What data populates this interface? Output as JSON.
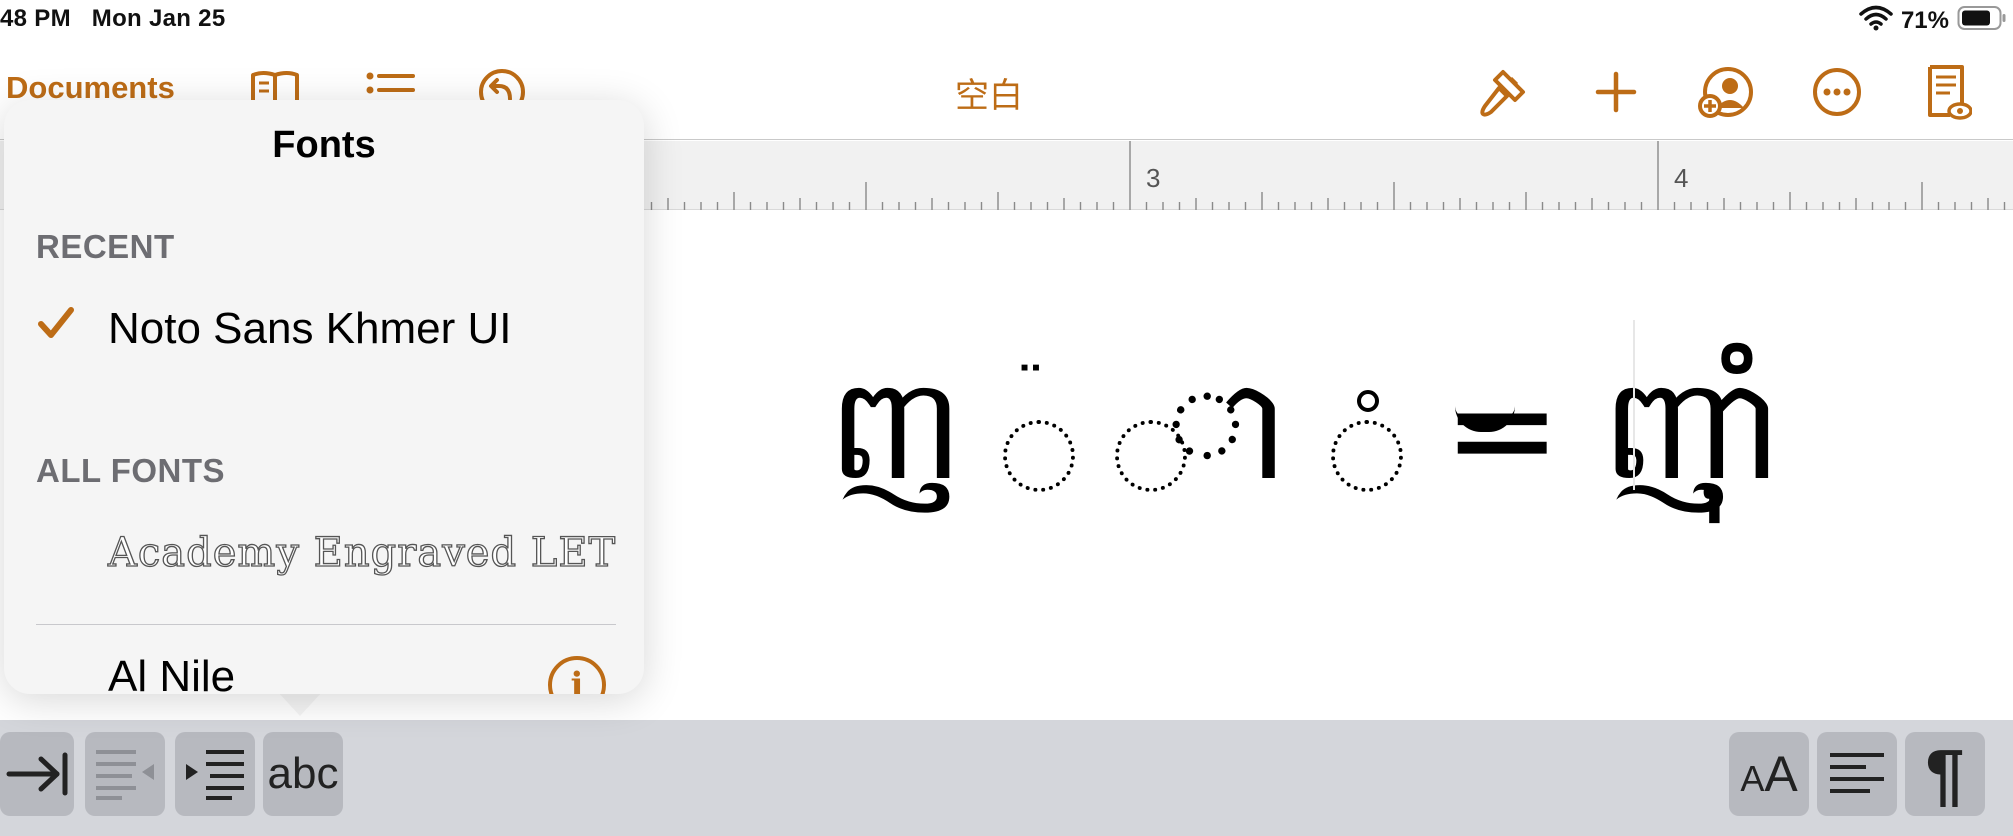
{
  "status_bar": {
    "time": "48 PM",
    "date": "Mon Jan 25",
    "battery_percent": "71%",
    "wifi_icon": "wifi-icon",
    "battery_icon": "battery-icon"
  },
  "toolbar": {
    "documents_label": "Documents",
    "document_title": "空白",
    "accent_color": "#bd6c16",
    "left_icons": [
      "book-icon",
      "list-icon",
      "undo-icon"
    ],
    "right_icons": [
      "paintbrush-icon",
      "plus-icon",
      "collaborate-icon",
      "more-icon",
      "document-view-icon"
    ]
  },
  "ruler": {
    "labels": [
      "3",
      "4"
    ]
  },
  "document": {
    "glyph_1": "ញ",
    "glyph_2": "̈",
    "glyph_3": "ា",
    "glyph_4": "ំ",
    "equals": "=",
    "result": "ញ៉ាំ"
  },
  "fonts_popover": {
    "title": "Fonts",
    "recent_header": "RECENT",
    "recent_fonts": [
      {
        "name": "Noto Sans Khmer UI",
        "selected": true
      }
    ],
    "all_fonts_header": "ALL FONTS",
    "all_fonts": [
      {
        "name": "Academy Engraved LET"
      },
      {
        "name": "Al Nile",
        "has_info": true
      }
    ]
  },
  "bottom_bar": {
    "abc_label": "abc",
    "text_size_label_small": "A",
    "text_size_label_large": "A",
    "pilcrow": "¶",
    "icons": [
      "tab-indent-icon",
      "decrease-indent-icon",
      "increase-indent-icon",
      "abc-button",
      "text-size-icon",
      "align-left-icon",
      "paragraph-icon"
    ]
  }
}
